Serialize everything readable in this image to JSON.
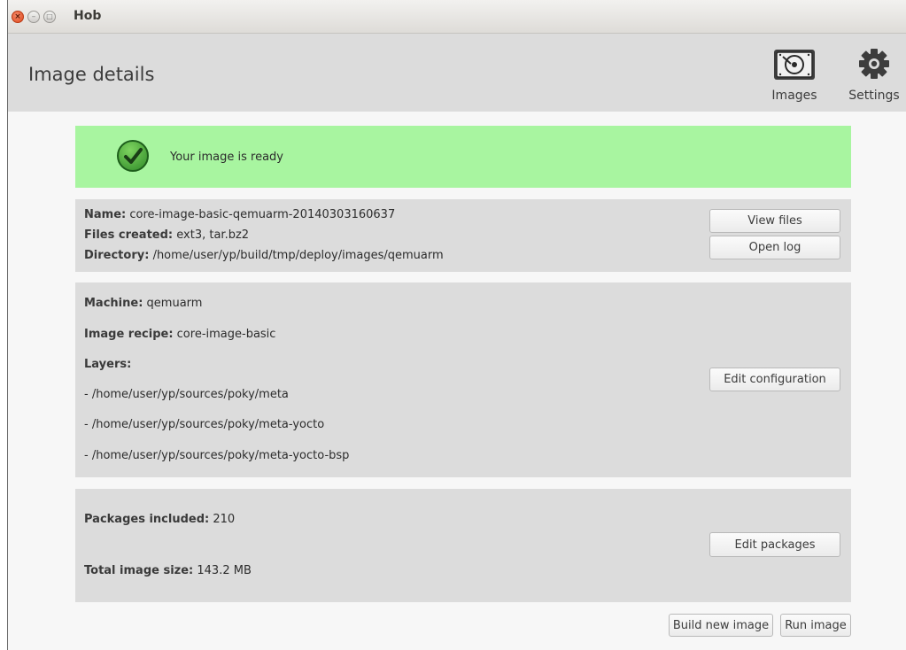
{
  "window": {
    "title": "Hob",
    "controls": {
      "close": "×",
      "minimize": "–",
      "maximize": "□"
    }
  },
  "header": {
    "page_title": "Image details",
    "toolbar": [
      {
        "label": "Images",
        "icon": "hard-disk-icon"
      },
      {
        "label": "Settings",
        "icon": "gear-icon"
      }
    ]
  },
  "status": {
    "message": "Your image is ready",
    "icon": "checkmark-icon",
    "color": "#a8f5a0"
  },
  "image_info": {
    "name_label": "Name:",
    "name_value": "core-image-basic-qemuarm-20140303160637",
    "files_label": "Files created:",
    "files_value": "ext3, tar.bz2",
    "directory_label": "Directory:",
    "directory_value": "/home/user/yp/build/tmp/deploy/images/qemuarm",
    "view_files_label": "View files",
    "open_log_label": "Open log"
  },
  "configuration": {
    "machine_label": "Machine:",
    "machine_value": "qemuarm",
    "recipe_label": "Image recipe:",
    "recipe_value": "core-image-basic",
    "layers_label": "Layers:",
    "layers": [
      "- /home/user/yp/sources/poky/meta",
      "- /home/user/yp/sources/poky/meta-yocto",
      "- /home/user/yp/sources/poky/meta-yocto-bsp"
    ],
    "edit_configuration_label": "Edit configuration"
  },
  "packages": {
    "packages_label": "Packages included:",
    "packages_value": "210",
    "size_label": "Total image size:",
    "size_value": "143.2 MB",
    "edit_packages_label": "Edit packages"
  },
  "footer": {
    "build_new_image_label": "Build new image",
    "run_image_label": "Run image"
  }
}
